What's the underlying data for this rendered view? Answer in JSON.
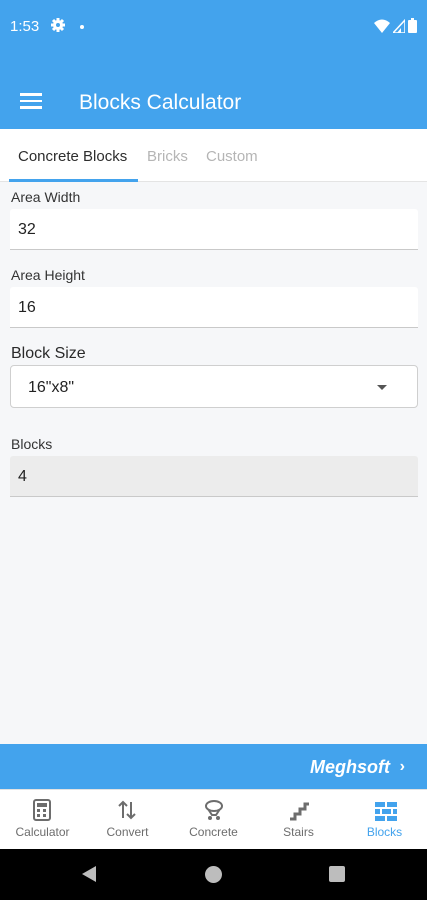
{
  "status": {
    "time": "1:53"
  },
  "app_bar": {
    "title": "Blocks Calculator"
  },
  "tabs": [
    {
      "label": "Concrete Blocks",
      "active": true
    },
    {
      "label": "Bricks",
      "active": false
    },
    {
      "label": "Custom",
      "active": false
    }
  ],
  "form": {
    "area_width": {
      "label": "Area Width",
      "value": "32"
    },
    "area_height": {
      "label": "Area Height",
      "value": "16"
    },
    "block_size": {
      "label": "Block Size",
      "value": "16\"x8\""
    },
    "blocks": {
      "label": "Blocks",
      "value": "4"
    }
  },
  "banner": {
    "text": "Meghsoft",
    "chevron": "›"
  },
  "bottom_nav": [
    {
      "label": "Calculator",
      "icon": "calculator-icon",
      "active": false
    },
    {
      "label": "Convert",
      "icon": "convert-arrows-icon",
      "active": false
    },
    {
      "label": "Concrete",
      "icon": "concrete-mixer-icon",
      "active": false
    },
    {
      "label": "Stairs",
      "icon": "stairs-icon",
      "active": false
    },
    {
      "label": "Blocks",
      "icon": "blocks-icon",
      "active": true
    }
  ],
  "colors": {
    "primary": "#43a3ed",
    "background": "#f6f7f9",
    "nav_inactive": "#6d6d6d"
  }
}
